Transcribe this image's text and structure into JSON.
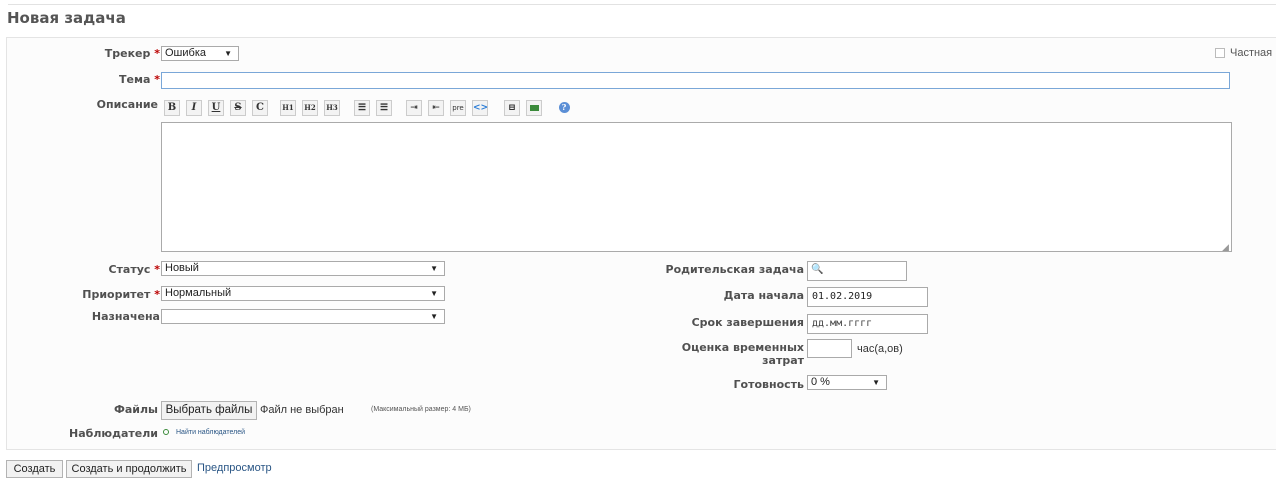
{
  "page": {
    "title": "Новая задача"
  },
  "form": {
    "tracker": {
      "label": "Трекер",
      "value": "Ошибка"
    },
    "private": {
      "label": "Частная"
    },
    "subject": {
      "label": "Тема",
      "value": ""
    },
    "description": {
      "label": "Описание",
      "value": ""
    },
    "toolbar": {
      "bold": "B",
      "italic": "I",
      "underline": "U",
      "strike": "S",
      "code": "C",
      "h1": "H1",
      "h2": "H2",
      "h3": "H3",
      "pre": "pre"
    },
    "status": {
      "label": "Статус",
      "value": "Новый"
    },
    "priority": {
      "label": "Приоритет",
      "value": "Нормальный"
    },
    "assignee": {
      "label": "Назначена",
      "value": ""
    },
    "parent": {
      "label": "Родительская задача",
      "value": ""
    },
    "start_date": {
      "label": "Дата начала",
      "value": "01.02.2019"
    },
    "due_date": {
      "label": "Срок завершения",
      "value": "дд.мм.гггг"
    },
    "estimate": {
      "label_line1": "Оценка временных",
      "label_line2": "затрат",
      "unit": "час(а,ов)",
      "value": ""
    },
    "done": {
      "label": "Готовность",
      "value": "0 %"
    },
    "files": {
      "label": "Файлы",
      "button": "Выбрать файлы",
      "status": "Файл не выбран",
      "max_size": "(Максимальный размер: 4 МБ)"
    },
    "watchers": {
      "label": "Наблюдатели",
      "link": "Найти наблюдателей"
    }
  },
  "actions": {
    "create": "Создать",
    "create_continue": "Создать и продолжить",
    "preview": "Предпросмотр"
  }
}
